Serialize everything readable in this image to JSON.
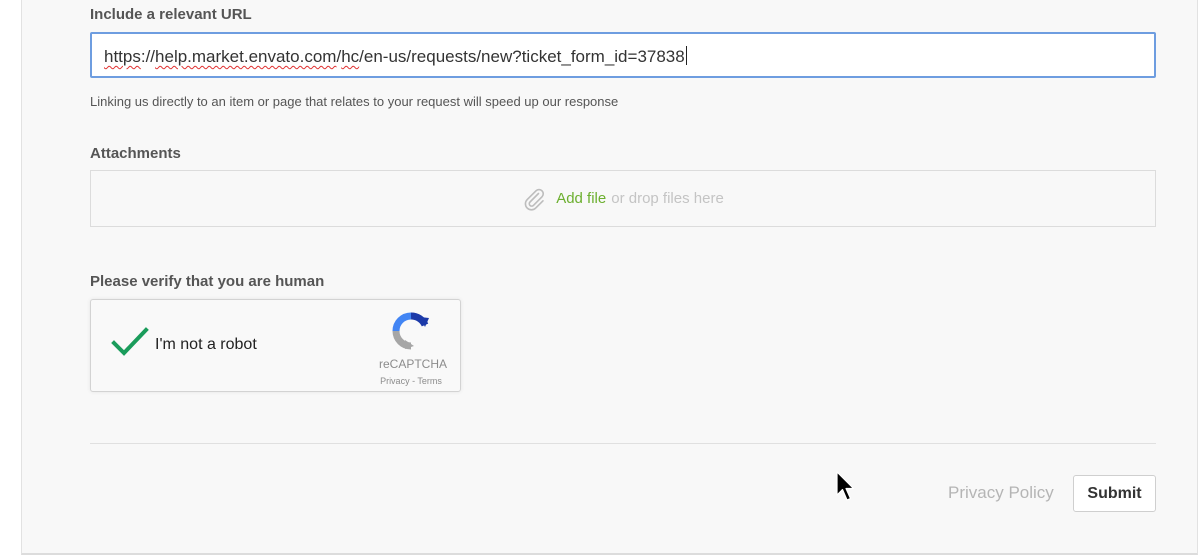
{
  "url_field": {
    "label": "Include a relevant URL",
    "value_parts": [
      "https",
      "://",
      "help.market.envato.com",
      "/",
      "hc",
      "/en-us/requests/new?ticket_form_id=37838"
    ],
    "hint": "Linking us directly to an item or page that relates to your request will speed up our response"
  },
  "attachments": {
    "label": "Attachments",
    "add_file": "Add file",
    "drop_hint": "or drop files here",
    "icon": "paperclip-icon"
  },
  "verify": {
    "label": "Please verify that you are human",
    "checkbox_label": "I'm not a robot",
    "checked": true,
    "brand": "reCAPTCHA",
    "privacy_link": "Privacy",
    "separator": " - ",
    "terms_link": "Terms"
  },
  "footer": {
    "privacy_policy": "Privacy Policy",
    "submit": "Submit"
  },
  "colors": {
    "accent_green": "#6caf2f",
    "check_green": "#1a9c5b",
    "input_focus_border": "#6e9de0",
    "panel_bg": "#f8f8f8"
  }
}
